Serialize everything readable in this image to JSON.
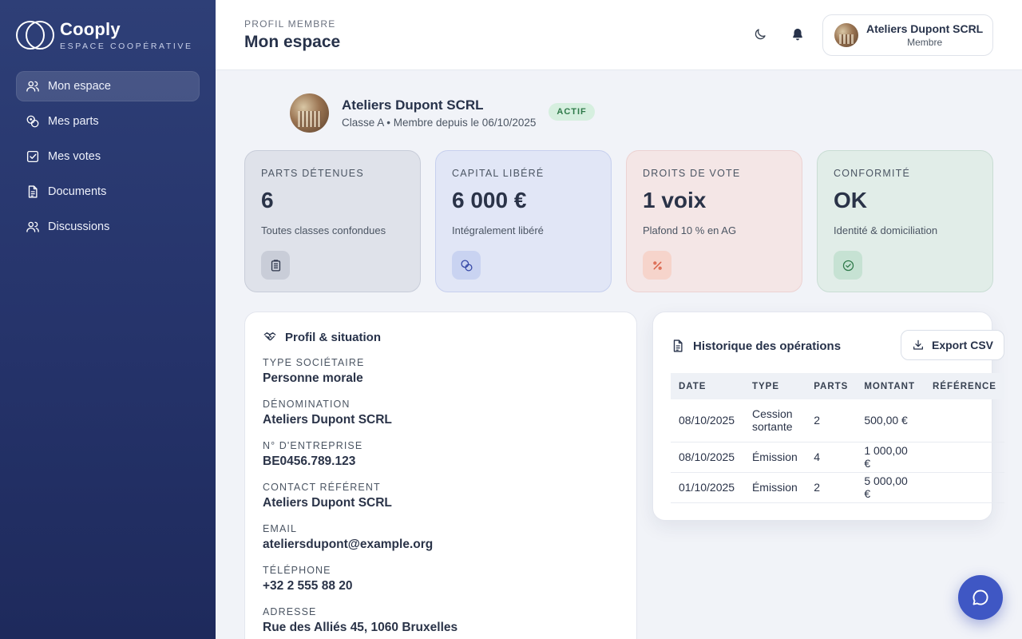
{
  "brand": {
    "name": "Cooply",
    "subtitle": "ESPACE COOPÉRATIVE"
  },
  "sidebar": {
    "items": [
      {
        "label": "Mon espace",
        "icon": "users-icon",
        "active": true
      },
      {
        "label": "Mes parts",
        "icon": "coins-icon"
      },
      {
        "label": "Mes votes",
        "icon": "checkbox-icon"
      },
      {
        "label": "Documents",
        "icon": "document-icon"
      },
      {
        "label": "Discussions",
        "icon": "users-icon"
      }
    ]
  },
  "header": {
    "eyebrow": "PROFIL MEMBRE",
    "title": "Mon espace",
    "user": {
      "name": "Ateliers Dupont SCRL",
      "role": "Membre"
    }
  },
  "member": {
    "name": "Ateliers Dupont SCRL",
    "subtitle": "Classe A • Membre depuis le 06/10/2025",
    "status": "ACTIF"
  },
  "kpis": [
    {
      "label": "PARTS DÉTENUES",
      "value": "6",
      "sub": "Toutes classes confondues",
      "icon": "clipboard-icon"
    },
    {
      "label": "CAPITAL LIBÉRÉ",
      "value": "6 000 €",
      "sub": "Intégralement libéré",
      "icon": "coins-icon"
    },
    {
      "label": "DROITS DE VOTE",
      "value": "1 voix",
      "sub": "Plafond 10 % en AG",
      "icon": "percent-icon"
    },
    {
      "label": "CONFORMITÉ",
      "value": "OK",
      "sub": "Identité & domiciliation",
      "icon": "check-circle-icon"
    }
  ],
  "profile": {
    "title": "Profil & situation",
    "fields": [
      {
        "label": "TYPE SOCIÉTAIRE",
        "value": "Personne morale"
      },
      {
        "label": "DÉNOMINATION",
        "value": "Ateliers Dupont SCRL"
      },
      {
        "label": "N° D'ENTREPRISE",
        "value": "BE0456.789.123"
      },
      {
        "label": "CONTACT RÉFÉRENT",
        "value": "Ateliers Dupont SCRL"
      },
      {
        "label": "EMAIL",
        "value": "ateliersdupont@example.org"
      },
      {
        "label": "TÉLÉPHONE",
        "value": "+32 2 555 88 20"
      },
      {
        "label": "ADRESSE",
        "value": "Rue des Alliés 45, 1060 Bruxelles"
      }
    ]
  },
  "history": {
    "title": "Historique des opérations",
    "export_label": "Export CSV",
    "columns": [
      "DATE",
      "TYPE",
      "PARTS",
      "MONTANT",
      "RÉFÉRENCE"
    ],
    "rows": [
      {
        "date": "08/10/2025",
        "type": "Cession sortante",
        "parts": "2",
        "amount": "500,00 €",
        "ref": ""
      },
      {
        "date": "08/10/2025",
        "type": "Émission",
        "parts": "4",
        "amount": "1 000,00 €",
        "ref": ""
      },
      {
        "date": "01/10/2025",
        "type": "Émission",
        "parts": "2",
        "amount": "5 000,00 €",
        "ref": ""
      }
    ]
  }
}
